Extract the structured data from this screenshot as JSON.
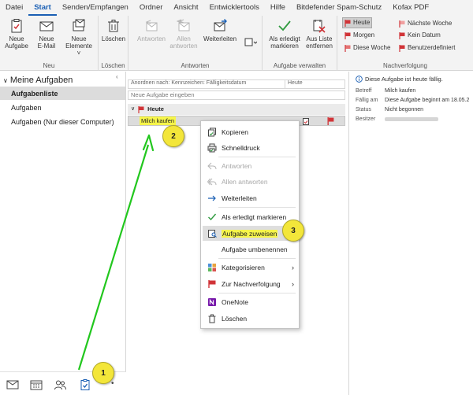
{
  "menu_tabs": [
    "Datei",
    "Start",
    "Senden/Empfangen",
    "Ordner",
    "Ansicht",
    "Entwicklertools",
    "Hilfe",
    "Bitdefender Spam-Schutz",
    "Kofax PDF"
  ],
  "active_tab": "Start",
  "ribbon": {
    "neu": {
      "label": "Neu",
      "new_task": [
        "Neue",
        "Aufgabe"
      ],
      "new_email": [
        "Neue",
        "E-Mail"
      ],
      "new_items": [
        "Neue",
        "Elemente ˅"
      ]
    },
    "loeschen": {
      "label": "Löschen",
      "delete": "Löschen"
    },
    "antworten": {
      "label": "Antworten",
      "reply": "Antworten",
      "reply_all": [
        "Allen",
        "antworten"
      ],
      "forward": "Weiterleiten"
    },
    "verwalten": {
      "label": "Aufgabe verwalten",
      "mark_done": [
        "Als erledigt",
        "markieren"
      ],
      "remove": [
        "Aus Liste",
        "entfernen"
      ]
    },
    "nachverfolgung": {
      "label": "Nachverfolgung",
      "today": "Heute",
      "tomorrow": "Morgen",
      "this_week": "Diese Woche",
      "next_week": "Nächste Woche",
      "no_date": "Kein Datum",
      "custom": "Benutzerdefiniert"
    }
  },
  "nav": {
    "header": "Meine Aufgaben",
    "items": [
      "Aufgabenliste",
      "Aufgaben",
      "Aufgaben (Nur dieser Computer)"
    ],
    "selected": "Aufgabenliste"
  },
  "task_list": {
    "header_left": "Anordnen nach: Kennzeichen: Fälligkeitsdatum",
    "header_right": "Heute",
    "new_task_placeholder": "Neue Aufgabe eingeben",
    "group": "Heute",
    "tasks": [
      "Milch kaufen"
    ]
  },
  "reading_pane": {
    "info": "Diese Aufgabe ist heute fällig.",
    "props": [
      {
        "key": "Betreff",
        "value": "Milch kaufen"
      },
      {
        "key": "Fällig am",
        "value": "Diese Aufgabe beginnt am 18.05.2"
      },
      {
        "key": "Status",
        "value": "Nicht begonnen"
      },
      {
        "key": "Besitzer",
        "value": ""
      }
    ]
  },
  "context_menu": [
    {
      "label": "Kopieren",
      "icon": "copy-icon"
    },
    {
      "label": "Schnelldruck",
      "icon": "print-icon"
    },
    {
      "label": "Antworten",
      "icon": "reply-icon",
      "disabled": true
    },
    {
      "label": "Allen antworten",
      "icon": "reply-all-icon",
      "disabled": true
    },
    {
      "label": "Weiterleiten",
      "icon": "forward-icon"
    },
    {
      "label": "Als erledigt markieren",
      "icon": "check-icon"
    },
    {
      "label": "Aufgabe zuweisen",
      "icon": "assign-task-icon",
      "highlighted": true
    },
    {
      "label": "Aufgabe umbenennen"
    },
    {
      "label": "Kategorisieren",
      "icon": "categorize-icon",
      "submenu": true
    },
    {
      "label": "Zur Nachverfolgung",
      "icon": "flag-icon",
      "submenu": true
    },
    {
      "label": "OneNote",
      "icon": "onenote-icon"
    },
    {
      "label": "Löschen",
      "icon": "trash-icon"
    }
  ],
  "annotations": [
    "1",
    "2",
    "3"
  ],
  "colors": {
    "accent_blue": "#1a5fb4",
    "flag_red": "#d13438",
    "highlight_yellow": "#f6f54a",
    "arrow_green": "#22c71e",
    "badge_yellow": "#f3e63a"
  }
}
